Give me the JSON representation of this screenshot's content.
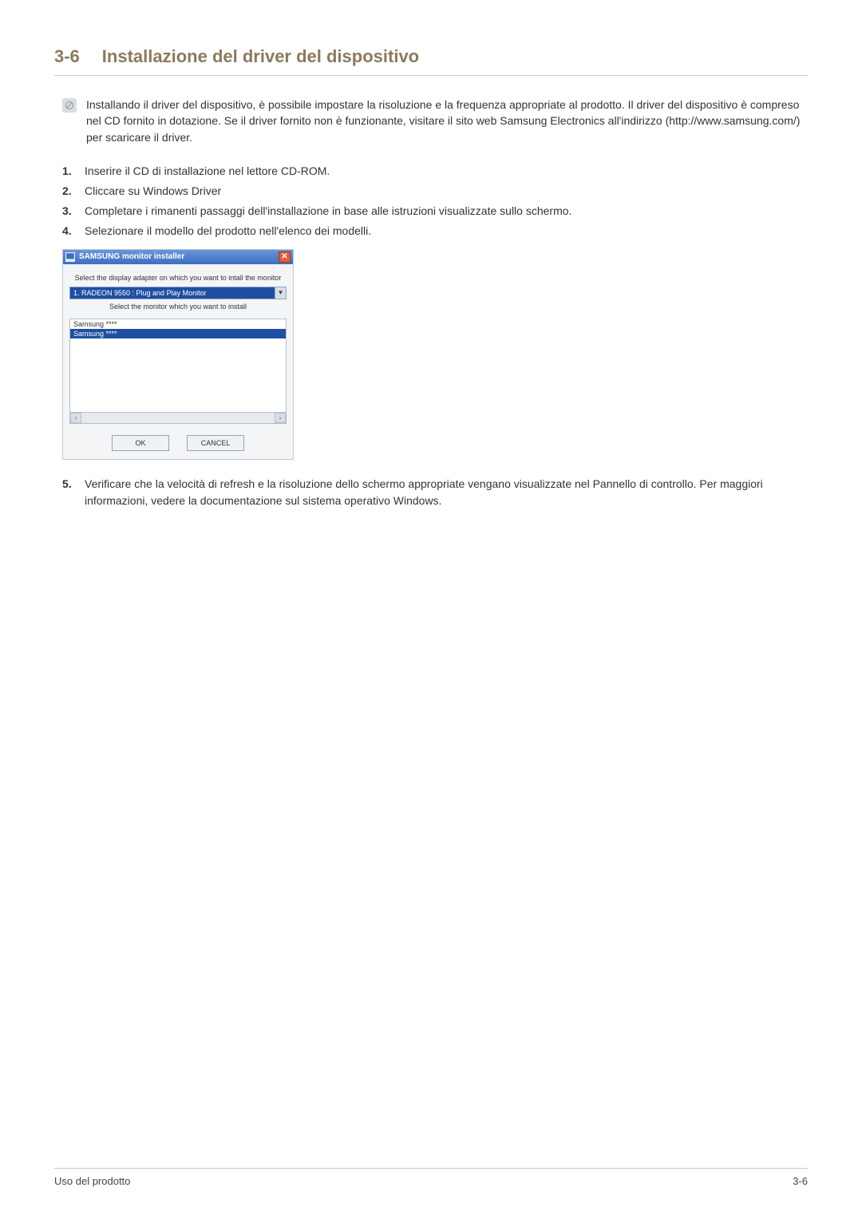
{
  "heading": {
    "number": "3-6",
    "title": "Installazione del driver del dispositivo"
  },
  "info": "Installando il driver del dispositivo, è possibile impostare la risoluzione e la frequenza appropriate al prodotto. Il driver del dispositivo è compreso nel CD fornito in dotazione. Se il driver fornito non è funzionante, visitare il sito web Samsung Electronics all'indirizzo (http://www.samsung.com/) per scaricare il driver.",
  "steps": [
    "Inserire il CD di installazione nel lettore CD-ROM.",
    "Cliccare su Windows Driver",
    "Completare i rimanenti passaggi dell'installazione in base alle istruzioni visualizzate sullo schermo.",
    "Selezionare il modello del prodotto nell'elenco dei modelli."
  ],
  "step5": "Verificare che la velocità di refresh e la risoluzione dello schermo appropriate vengano visualizzate nel Pannello di controllo. Per maggiori informazioni, vedere la documentazione sul sistema operativo Windows.",
  "dialog": {
    "title": "SAMSUNG monitor installer",
    "label_adapter": "Select the display adapter on which you want to intall the monitor",
    "adapter_value": "1. RADEON 9550 : Plug and Play Monitor",
    "label_monitor": "Select the monitor which you want to install",
    "monitors": [
      "Samsung ****",
      "Samsung ****"
    ],
    "btn_ok": "OK",
    "btn_cancel": "CANCEL"
  },
  "footer": {
    "left": "Uso del prodotto",
    "right": "3-6"
  }
}
